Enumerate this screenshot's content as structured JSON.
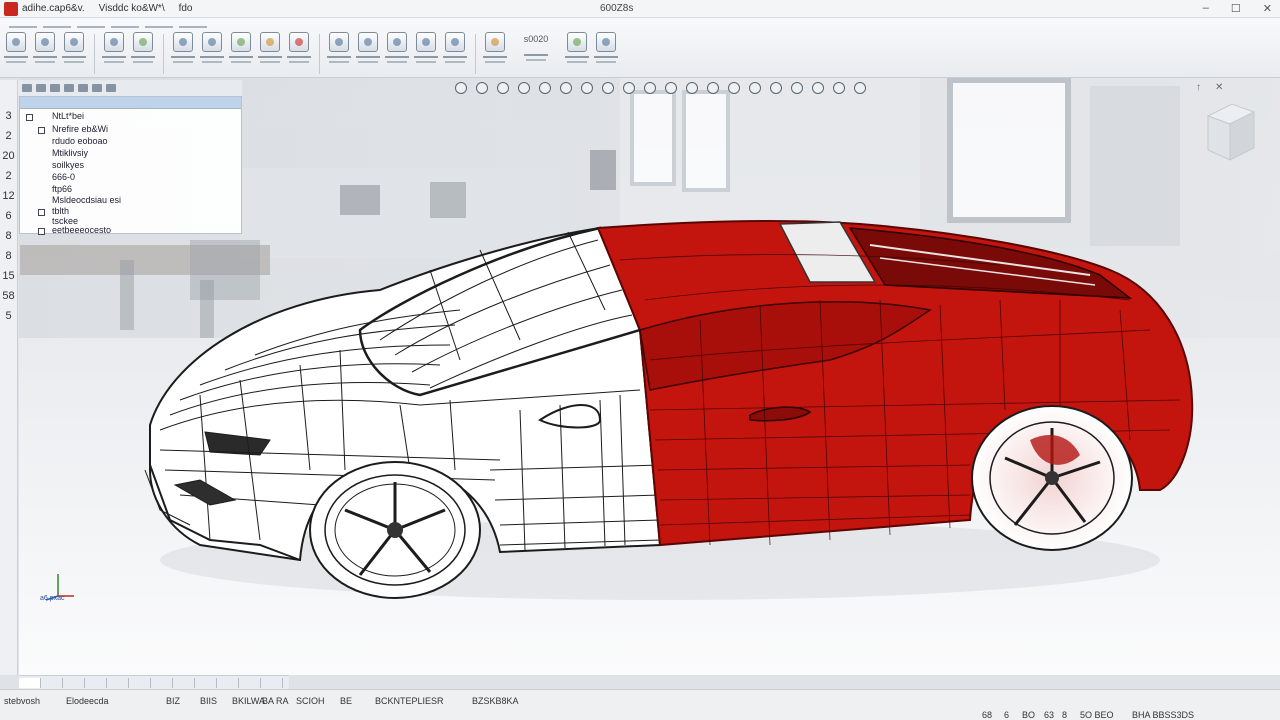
{
  "window": {
    "menu": [
      "adihe.cap6&v.",
      "Visddc ko&W*\\",
      "fdo"
    ],
    "document_title": "600Z8s",
    "controls": [
      "–",
      "☐",
      "✕"
    ]
  },
  "ribbon": {
    "group_text": "s0020",
    "tool_count": 20
  },
  "left_strip": {
    "items": [
      "3",
      "2",
      "20",
      "2",
      "12",
      "6",
      "8",
      "8",
      "15",
      "58",
      "5"
    ]
  },
  "feature_tree": {
    "items": [
      "NtLt*bei",
      "Nrefire eb&Wi",
      "rdudo eoboao",
      "Mtiklivsiy",
      "soilkyes",
      "666-0",
      "ftp66",
      "Msldeocdsiau esi",
      "tblth",
      "tsckee",
      "eetbeeeocesto"
    ]
  },
  "hud": {
    "buttons": 20
  },
  "triad": {
    "label": "a6 pxac"
  },
  "status": {
    "left": [
      "stebvosh",
      "Elodeecda",
      "BIZ",
      "BIIS",
      "BKILWA",
      "BA RA",
      "SCIOH",
      "BE",
      "BCKNTEPLIESR",
      "BZSKB8KA"
    ],
    "right": [
      "68",
      "6",
      "BO",
      "63",
      "8",
      "5O BEO",
      "BHA BBSS3DS"
    ]
  },
  "colors": {
    "paint": "#c4140e",
    "wire": "#1c1c1c",
    "tree_header": "#bfd3ea"
  }
}
